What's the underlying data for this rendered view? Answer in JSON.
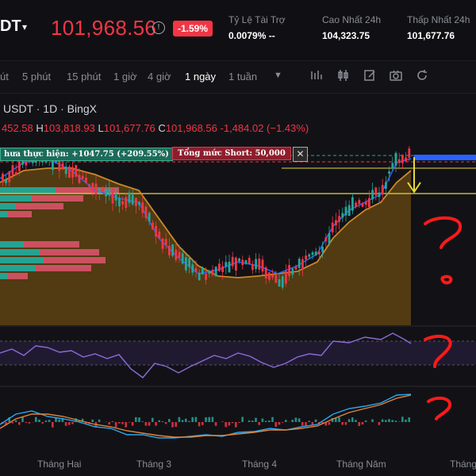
{
  "header": {
    "pair": "DT",
    "price": "101,968.56",
    "change_pct": "-1.59%",
    "stats": [
      {
        "label": "Tỷ Lệ Tài Trợ",
        "value": "0.0079% --"
      },
      {
        "label": "Cao Nhất 24h",
        "value": "104,323.75"
      },
      {
        "label": "Thấp Nhất 24h",
        "value": "101,677.76"
      }
    ]
  },
  "toolbar": {
    "timeframes": [
      "út",
      "5 phút",
      "15 phút",
      "1 giờ",
      "4 giờ",
      "1 ngày",
      "1 tuần"
    ],
    "active": "1 ngày",
    "icons": [
      "dropdown-caret-icon",
      "bars-icon",
      "candles-icon",
      "edit-icon",
      "image-icon",
      "camera-icon",
      "refresh-icon"
    ]
  },
  "chart": {
    "symbol_line": "USDT · 1D · BingX",
    "ohlc": {
      "open": "452.58",
      "high_label": "H",
      "high": "103,818.93",
      "low_label": "L",
      "low": "101,677.76",
      "close_label": "C",
      "close": "101,968.56",
      "change": "-1,484.02 (−1.43%)"
    },
    "tag_pnl": "hưa thực hiện: +1047.75 (+209.55%)",
    "tag_short": "Tổng mức Short: 50,000",
    "tag_close": "✕",
    "months": [
      "Tháng Hai",
      "Tháng 3",
      "Tháng 4",
      "Tháng Năm",
      "Tháng"
    ],
    "colors": {
      "up": "#26a69a",
      "down": "#f23645",
      "ma_fast": "#2962ff",
      "ma_slow": "#c98a2a",
      "fill": "#5a3f12",
      "target": "#e6d83a"
    }
  },
  "annotations": [
    "?",
    ".",
    "?",
    "?"
  ]
}
